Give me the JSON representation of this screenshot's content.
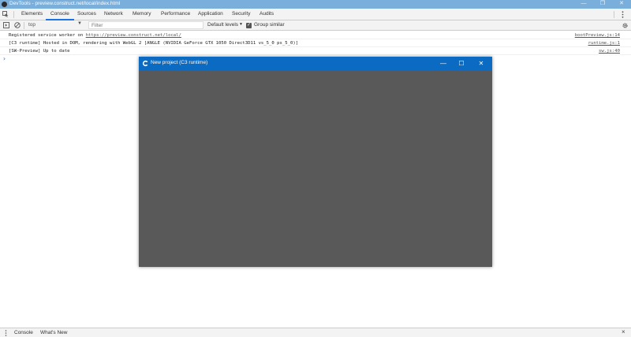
{
  "window": {
    "title": "DevTools - preview.construct.net/local/index.html",
    "minimize": "—",
    "restore": "❐",
    "close": "✕"
  },
  "tabs": [
    "Elements",
    "Console",
    "Sources",
    "Network",
    "Memory",
    "Performance",
    "Application",
    "Security",
    "Audits"
  ],
  "active_tab": "Console",
  "toolbar": {
    "context": "top",
    "filter_placeholder": "Filter",
    "levels": "Default levels",
    "group_similar": "Group similar"
  },
  "messages": [
    {
      "prefix": "Registered service worker on ",
      "link": "https://preview.construct.net/local/",
      "source": "bootPreview.js:14"
    },
    {
      "prefix": "[C3 runtime] Hosted in DOM, rendering with WebGL 2 [ANGLE (NVIDIA GeForce GTX 1050 Direct3D11 vs_5_0 ps_5_0)]",
      "link": "",
      "source": "runtime.js:1"
    },
    {
      "prefix": "[SW-Preview] Up to date",
      "link": "",
      "source": "sw.js:40"
    }
  ],
  "prompt": "›",
  "preview": {
    "title": "New project (C3 runtime)",
    "minimize": "—",
    "maximize": "☐",
    "close": "✕"
  },
  "drawer": {
    "tabs": [
      "Console",
      "What's New"
    ],
    "close": "×"
  },
  "colors": {
    "titlebar": "#7aaedb",
    "preview_titlebar": "#0b6ac1",
    "preview_body": "#595959",
    "accent": "#1a73e8"
  }
}
